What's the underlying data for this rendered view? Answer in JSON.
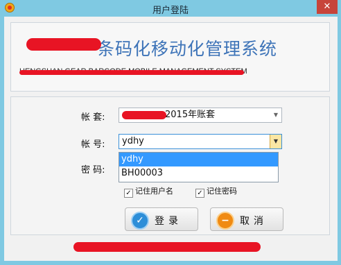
{
  "window": {
    "title": "用户登陆",
    "close_glyph": "✕"
  },
  "banner": {
    "title_suffix": "条码化移动化管理系统",
    "subtitle": "HENGSHAN GEAR BARCODE MOBILE MANAGEMENT SYSTEM"
  },
  "form": {
    "account_set_label": "帐  套:",
    "account_set_value": "2015年账套",
    "account_no_label": "帐  号:",
    "account_no_value": "ydhy",
    "account_options": [
      "ydhy",
      "BH00003"
    ],
    "password_label": "密  码:",
    "remember_user": "记住用户名",
    "remember_password": "记住密码"
  },
  "buttons": {
    "login": "登录",
    "cancel": "取消"
  },
  "colors": {
    "brand_blue": "#3e74b8",
    "title_bar": "#7fc9e2",
    "selection": "#3399ff"
  }
}
